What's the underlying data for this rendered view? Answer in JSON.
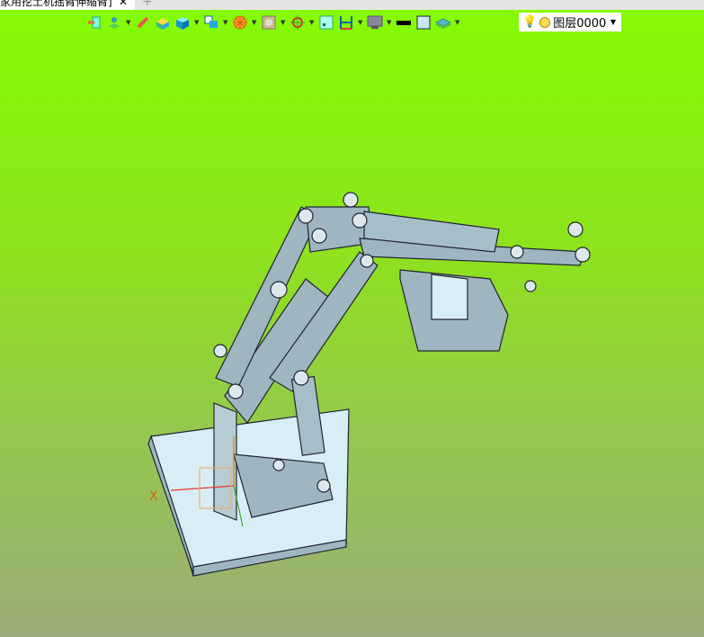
{
  "tab": {
    "title": "家用挖土机摇臂伸缩臂]",
    "close": "✕",
    "new_tab": "+"
  },
  "toolbar": {
    "icons": [
      "exit-sketch-icon",
      "layer-tool-icon",
      "measure-icon",
      "box-color-icon",
      "view-cube-icon",
      "view-orient-icon",
      "render-icon",
      "section-icon",
      "snap-icon",
      "frame-icon",
      "dimension-icon",
      "display-icon",
      "line-color-icon",
      "fill-color-icon",
      "layer-stack-icon"
    ],
    "layer_select": {
      "value": "图层0000"
    }
  },
  "viewport": {
    "axis_label": "X",
    "colors": {
      "bg_top": "#86fb04",
      "bg_bottom": "#9aac78",
      "part": "#9fb6c0",
      "base": "#d8eef4"
    }
  }
}
